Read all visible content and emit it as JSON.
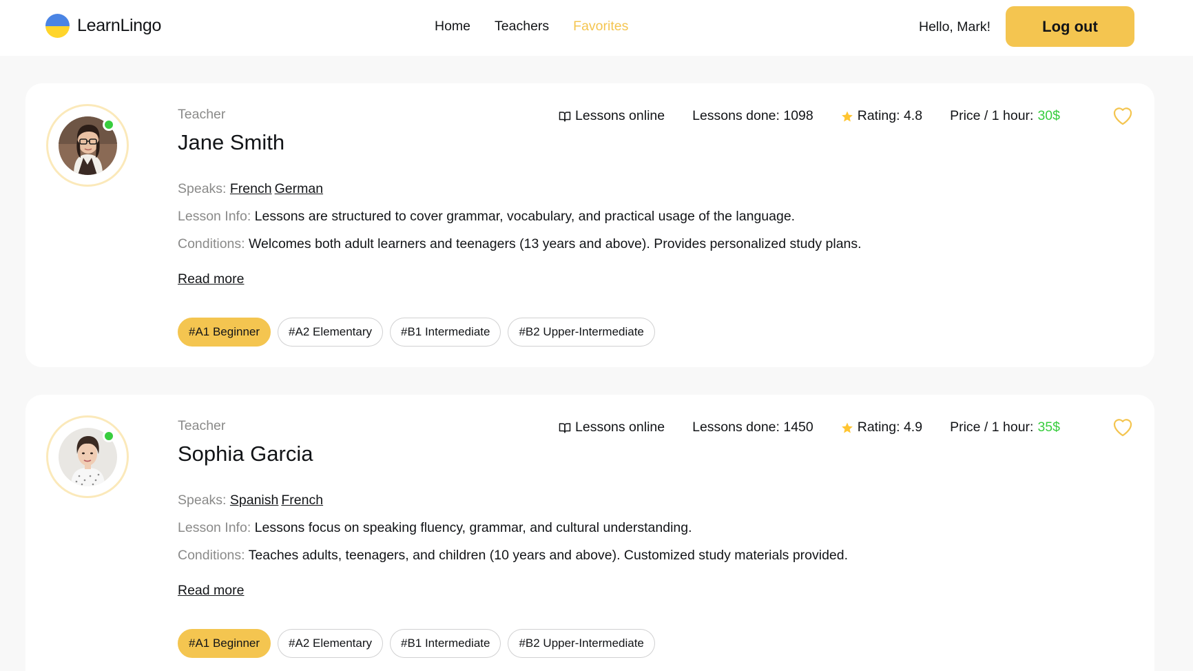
{
  "brand": {
    "name": "LearnLingo"
  },
  "nav": {
    "items": [
      "Home",
      "Teachers",
      "Favorites"
    ],
    "active": "Favorites"
  },
  "user": {
    "greeting": "Hello, Mark!",
    "logout_label": "Log out"
  },
  "colors": {
    "accent": "#f4c550",
    "online": "#38cd3e",
    "muted": "#8a8a89"
  },
  "common": {
    "teacher_label": "Teacher",
    "lessons_online": "Lessons online",
    "speaks_key": "Speaks:",
    "lesson_info_key": "Lesson Info:",
    "conditions_key": "Conditions:",
    "read_more": "Read more",
    "book_icon": "book-open-icon",
    "star_icon": "star-icon",
    "heart_icon": "heart-outline-icon"
  },
  "teachers": [
    {
      "name": "Jane Smith",
      "online": true,
      "lessons_done": "Lessons done: 1098",
      "rating": "Rating: 4.8",
      "price_label": "Price / 1 hour: ",
      "price_value": "30$",
      "languages": [
        "French",
        "German"
      ],
      "lesson_info": "Lessons are structured to cover grammar, vocabulary, and practical usage of the language.",
      "conditions": "Welcomes both adult learners and teenagers (13 years and above). Provides personalized study plans.",
      "levels": [
        "#A1 Beginner",
        "#A2 Elementary",
        "#B1 Intermediate",
        "#B2 Upper-Intermediate"
      ],
      "active_level": "#A1 Beginner"
    },
    {
      "name": "Sophia Garcia",
      "online": true,
      "lessons_done": "Lessons done: 1450",
      "rating": "Rating: 4.9",
      "price_label": "Price / 1 hour: ",
      "price_value": "35$",
      "languages": [
        "Spanish",
        "French"
      ],
      "lesson_info": "Lessons focus on speaking fluency, grammar, and cultural understanding.",
      "conditions": "Teaches adults, teenagers, and children (10 years and above). Customized study materials provided.",
      "levels": [
        "#A1 Beginner",
        "#A2 Elementary",
        "#B1 Intermediate",
        "#B2 Upper-Intermediate"
      ],
      "active_level": "#A1 Beginner"
    }
  ]
}
